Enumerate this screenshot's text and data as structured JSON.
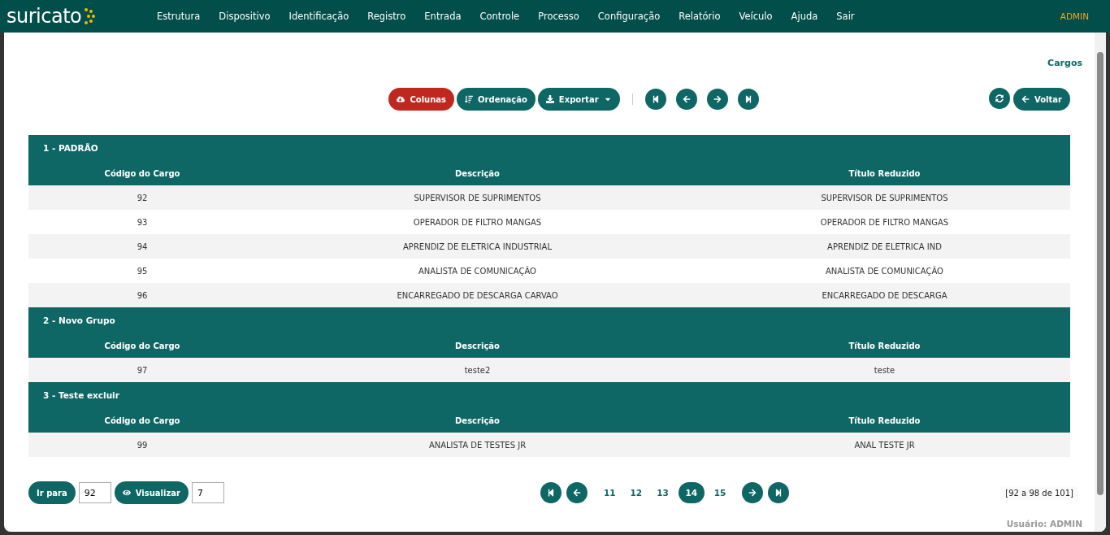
{
  "brand": {
    "name": "suricato"
  },
  "menu": [
    "Estrutura",
    "Dispositivo",
    "Identificação",
    "Registro",
    "Entrada",
    "Controle",
    "Processo",
    "Configuração",
    "Relatório",
    "Veículo",
    "Ajuda",
    "Sair"
  ],
  "user_badge": "ADMIN",
  "breadcrumb": "Cargos",
  "toolbar": {
    "buttons": [
      {
        "label": "Colunas",
        "kind": "danger"
      },
      {
        "label": "Ordenação",
        "kind": "primary"
      },
      {
        "label": "Exportar",
        "kind": "dropdown"
      }
    ],
    "back": "Voltar"
  },
  "groups": [
    {
      "title": "1 - PADRÃO",
      "columns": [
        "Código do Cargo",
        "Descrição",
        "Título Reduzido"
      ],
      "rows": [
        [
          "92",
          "SUPERVISOR DE SUPRIMENTOS",
          "SUPERVISOR DE SUPRIMENTOS"
        ],
        [
          "93",
          "OPERADOR DE FILTRO MANGAS",
          "OPERADOR DE FILTRO MANGAS"
        ],
        [
          "94",
          "APRENDIZ DE ELETRICA INDUSTRIAL",
          "APRENDIZ DE ELETRICA IND"
        ],
        [
          "95",
          "ANALISTA DE COMUNICAÇÃO",
          "ANALISTA DE COMUNICAÇÃO"
        ],
        [
          "96",
          "ENCARREGADO DE DESCARGA CARVAO",
          "ENCARREGADO DE DESCARGA"
        ]
      ]
    },
    {
      "title": "2 - Novo Grupo",
      "columns": [
        "Código do Cargo",
        "Descrição",
        "Título Reduzido"
      ],
      "rows": [
        [
          "97",
          "teste2",
          "teste"
        ]
      ]
    },
    {
      "title": "3 - Teste excluir",
      "columns": [
        "Código do Cargo",
        "Descrição",
        "Título Reduzido"
      ],
      "rows": [
        [
          "99",
          "ANALISTA DE TESTES JR",
          "ANAL TESTE JR"
        ]
      ]
    }
  ],
  "footer": {
    "goto_label": "Ir para",
    "goto_value": "92",
    "view_label": "Visualizar",
    "view_value": "7",
    "pages": [
      {
        "label": "11",
        "selected": false
      },
      {
        "label": "12",
        "selected": false
      },
      {
        "label": "13",
        "selected": false
      },
      {
        "label": "14",
        "selected": true
      },
      {
        "label": "15",
        "selected": false
      }
    ],
    "range": "[92 a 98 de 101]",
    "user": "Usuário: ADMIN"
  }
}
